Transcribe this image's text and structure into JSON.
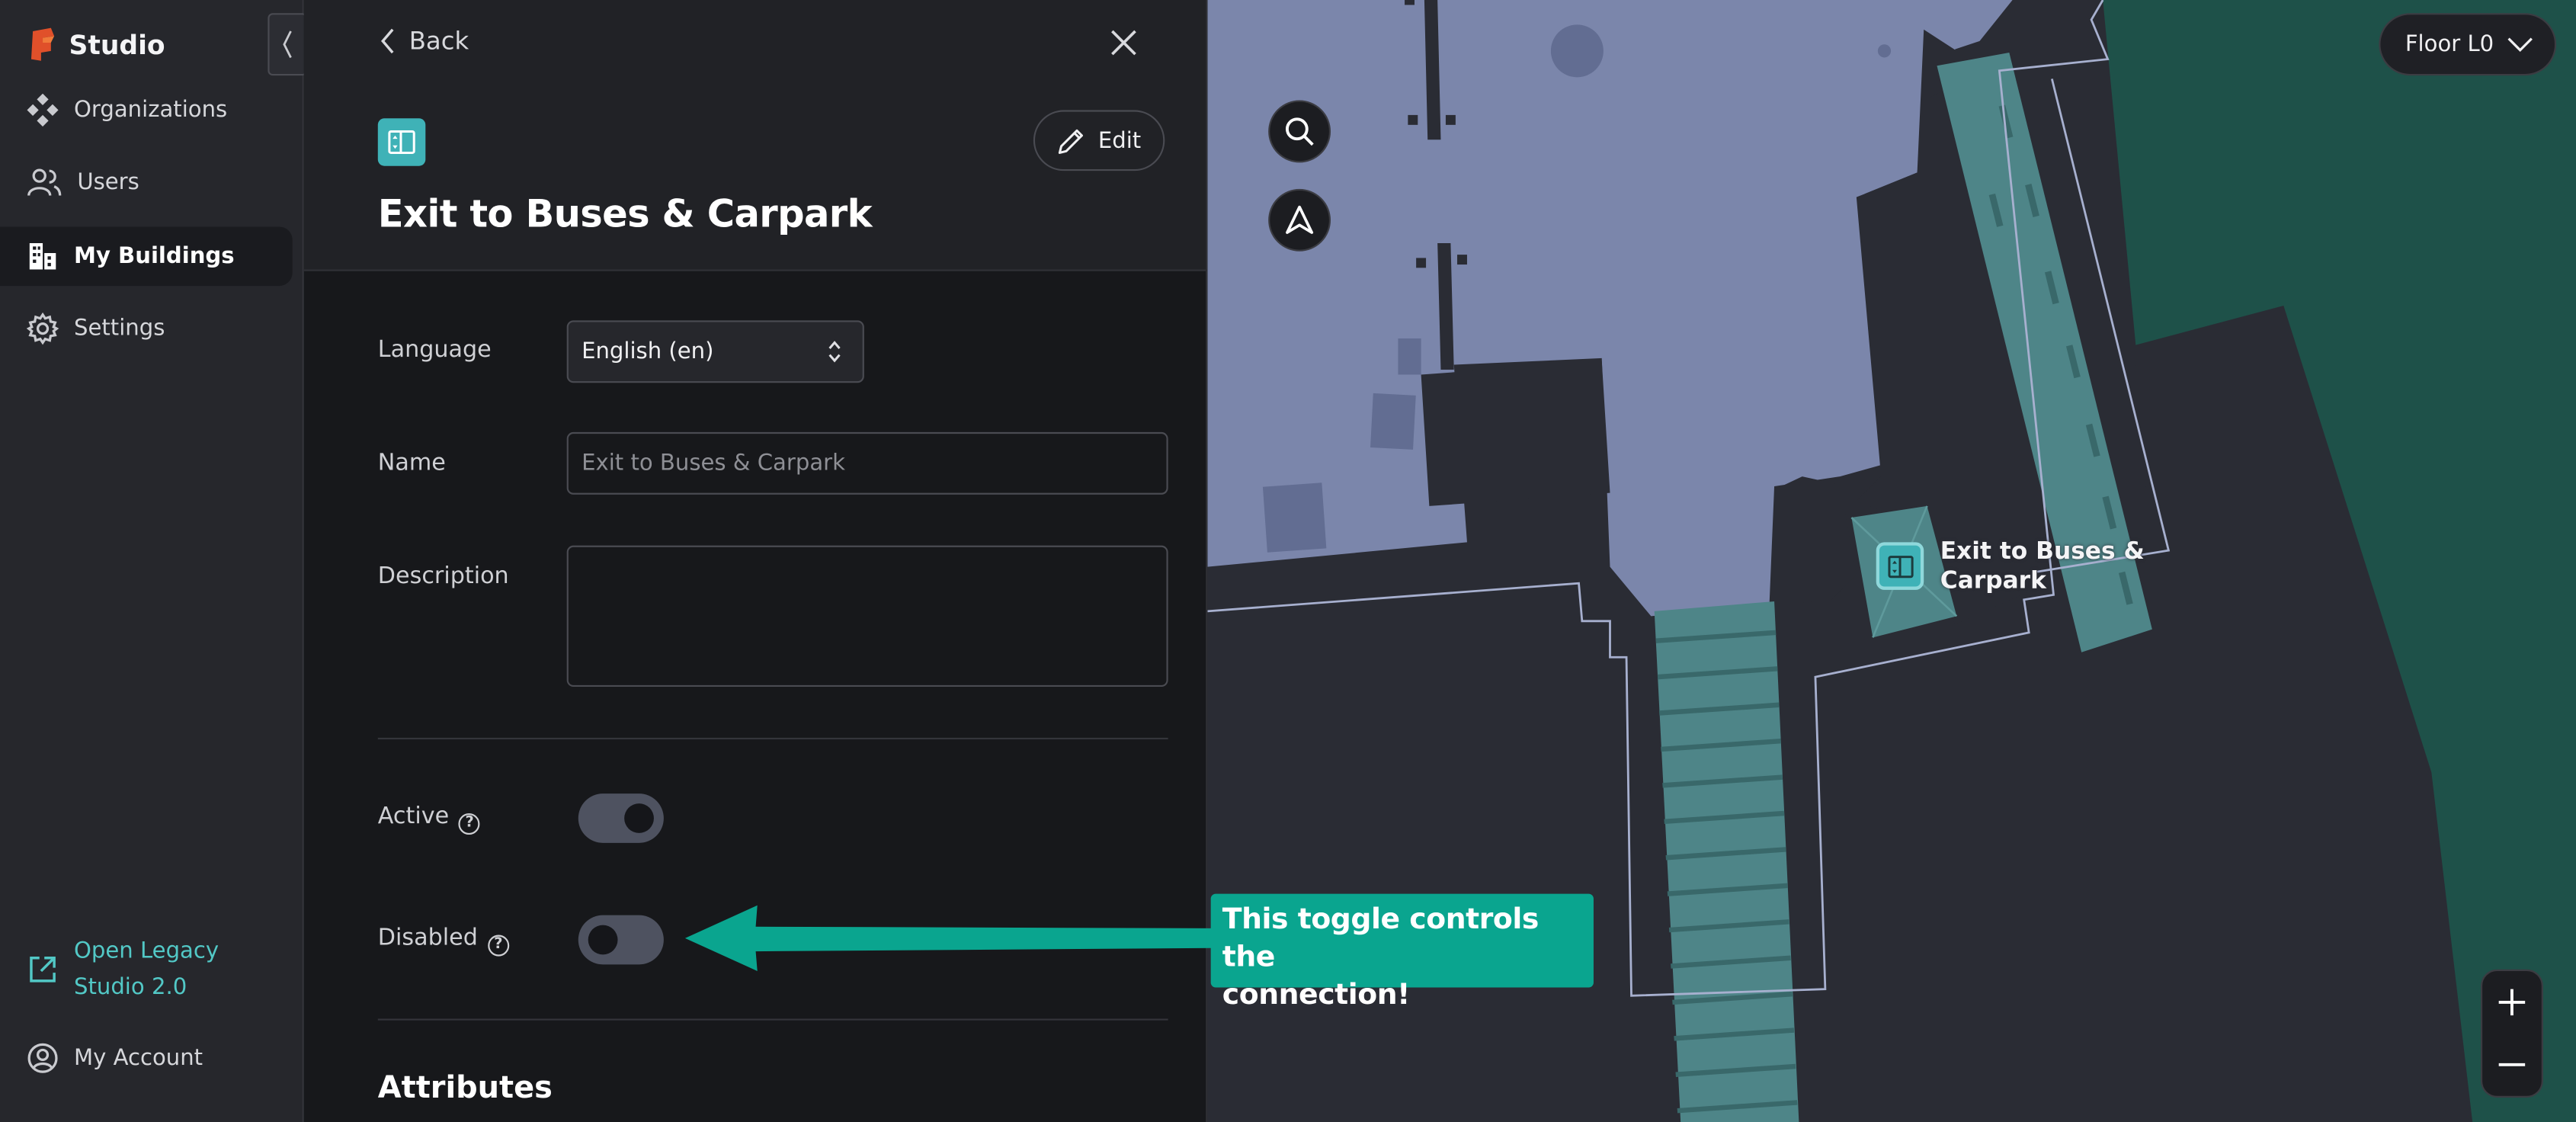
{
  "app": {
    "brand": "Studio"
  },
  "sidebar": {
    "items": [
      {
        "label": "Organizations",
        "icon": "organizations-icon",
        "active": false
      },
      {
        "label": "Users",
        "icon": "users-icon",
        "active": false
      },
      {
        "label": "My Buildings",
        "icon": "buildings-icon",
        "active": true
      },
      {
        "label": "Settings",
        "icon": "gear-icon",
        "active": false
      }
    ],
    "legacy_link_line1": "Open Legacy",
    "legacy_link_line2": "Studio 2.0",
    "account": "My Account"
  },
  "panel": {
    "back_label": "Back",
    "edit_label": "Edit",
    "title": "Exit to Buses & Carpark",
    "language_label": "Language",
    "language_value": "English (en)",
    "name_label": "Name",
    "name_placeholder": "Exit to Buses & Carpark",
    "description_label": "Description",
    "active_label": "Active",
    "disabled_label": "Disabled",
    "help_glyph": "?",
    "attributes_title": "Attributes"
  },
  "map": {
    "floor_label": "Floor L0",
    "poi_label_line1": "Exit to Buses &",
    "poi_label_line2": "Carpark",
    "colors": {
      "building": "#7b86ab",
      "corridor": "#4e8588",
      "outside": "#1e5149",
      "ground": "#2a2c34"
    }
  },
  "annotation": {
    "text_line1": "This toggle controls the",
    "text_line2": "connection!",
    "color": "#0aa58f"
  }
}
